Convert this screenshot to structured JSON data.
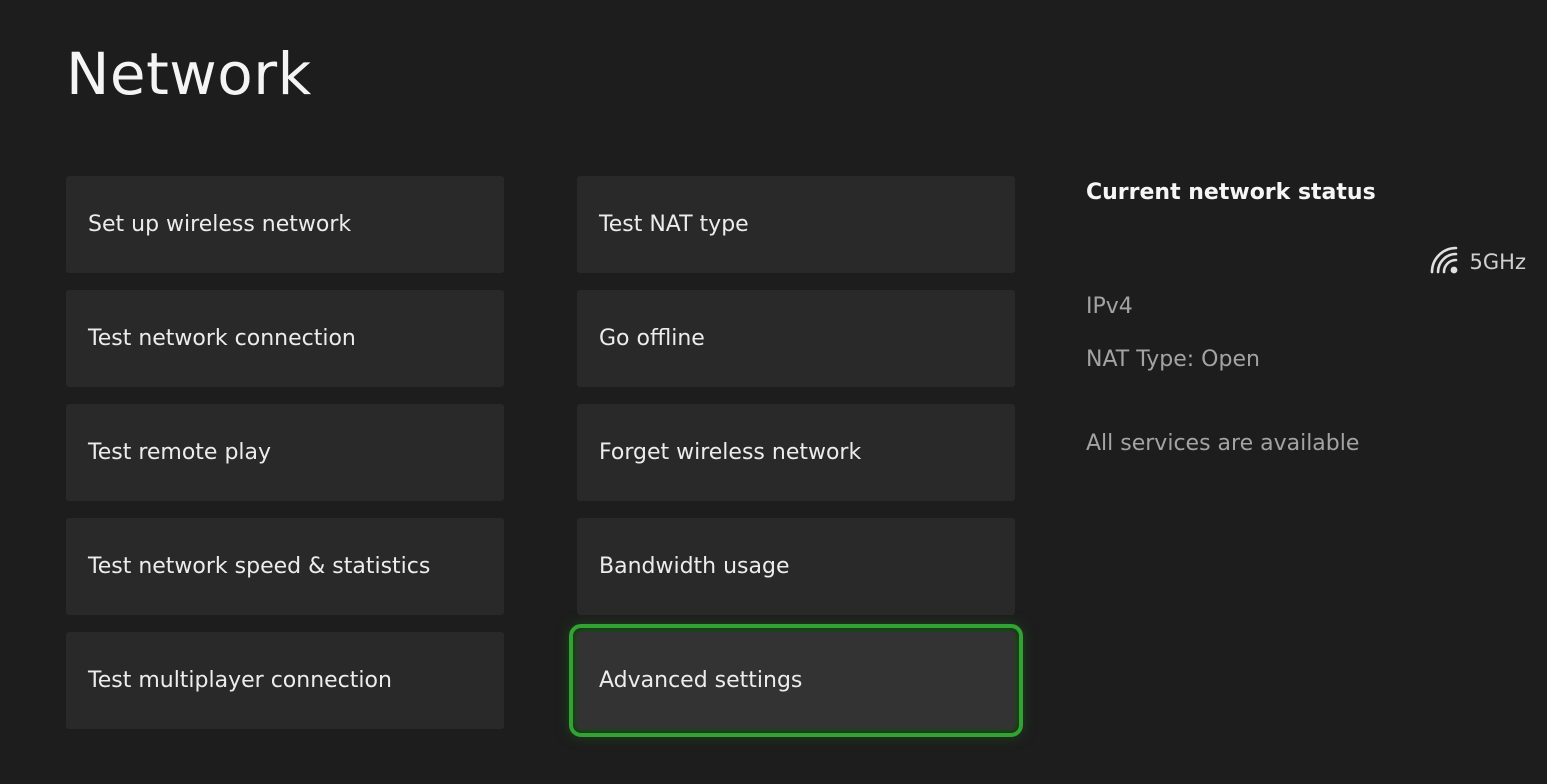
{
  "page": {
    "title": "Network"
  },
  "menu": {
    "left": [
      {
        "label": "Set up wireless network"
      },
      {
        "label": "Test network connection"
      },
      {
        "label": "Test remote play"
      },
      {
        "label": "Test network speed & statistics"
      },
      {
        "label": "Test multiplayer connection"
      }
    ],
    "right": [
      {
        "label": "Test NAT type"
      },
      {
        "label": "Go offline"
      },
      {
        "label": "Forget wireless network"
      },
      {
        "label": "Bandwidth usage"
      },
      {
        "label": "Advanced settings",
        "focused": true
      }
    ]
  },
  "status": {
    "heading": "Current network status",
    "wifi_icon": "wifi-icon",
    "band": "5GHz",
    "ip_version": "IPv4",
    "nat_type": "NAT Type: Open",
    "services": "All services are available"
  },
  "colors": {
    "background": "#1d1d1d",
    "tile": "#292929",
    "tile_focused": "#333333",
    "focus_accent": "#32a232"
  }
}
